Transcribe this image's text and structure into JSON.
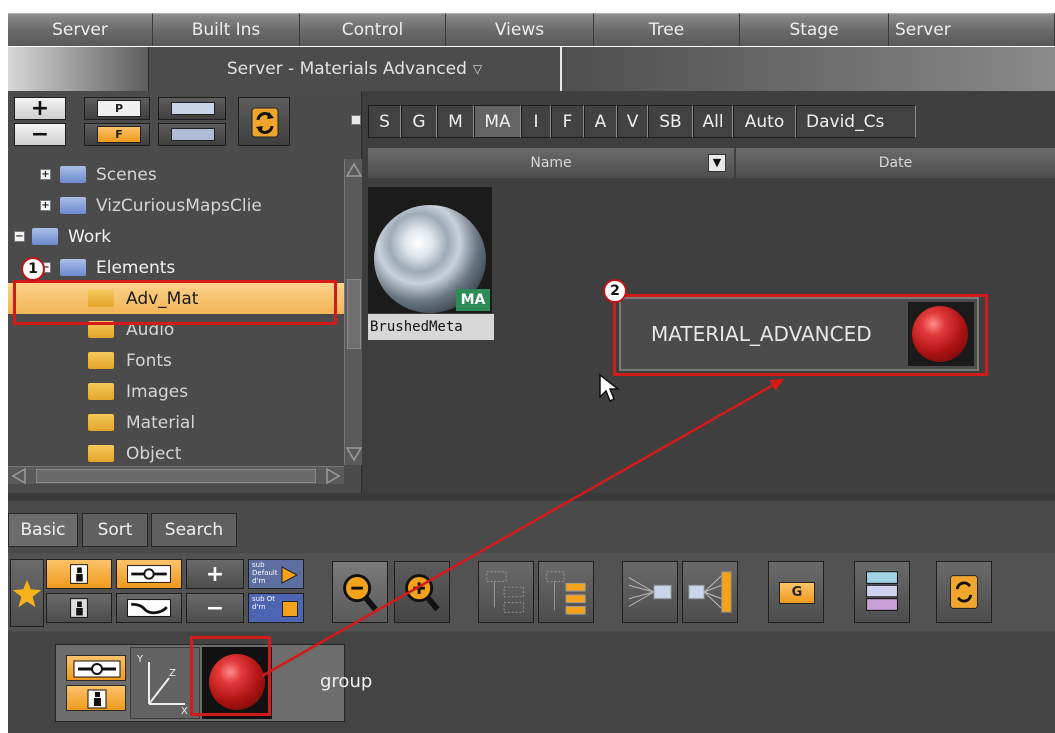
{
  "menu": {
    "items": [
      "Server",
      "Built Ins",
      "Control",
      "Views",
      "Tree",
      "Stage",
      "Server"
    ]
  },
  "title": {
    "combo_label": "Server - Materials Advanced",
    "combo_arrow": "▽"
  },
  "left_toolbar": {
    "add_label": "+",
    "remove_label": "−",
    "project_badge": "P",
    "folder_badge": "F"
  },
  "tree": {
    "rows": [
      {
        "label": "Scenes",
        "expander": "+",
        "icon": "blue-folder"
      },
      {
        "label": "VizCuriousMapsClie",
        "expander": "+",
        "icon": "blue-folder"
      },
      {
        "label": "Work",
        "expander": "−",
        "icon": "blue-folder-open"
      },
      {
        "label": "Elements",
        "expander": "−",
        "icon": "blue-folder-open"
      },
      {
        "label": "Adv_Mat",
        "icon": "yellow-folder",
        "selected": true
      },
      {
        "label": "Audio",
        "icon": "yellow-folder"
      },
      {
        "label": "Fonts",
        "icon": "yellow-folder"
      },
      {
        "label": "Images",
        "icon": "yellow-folder"
      },
      {
        "label": "Material",
        "icon": "yellow-folder"
      },
      {
        "label": "Object",
        "icon": "yellow-folder"
      }
    ]
  },
  "filter_tabs": [
    {
      "label": "S"
    },
    {
      "label": "G"
    },
    {
      "label": "M"
    },
    {
      "label": "MA",
      "active": true
    },
    {
      "label": "I"
    },
    {
      "label": "F"
    },
    {
      "label": "A"
    },
    {
      "label": "V"
    },
    {
      "label": "SB"
    },
    {
      "label": "All"
    },
    {
      "label": "Auto"
    },
    {
      "label": "David_Cs"
    }
  ],
  "columns": {
    "name": "Name",
    "date": "Date",
    "dropdown_glyph": "▼"
  },
  "asset": {
    "name": "BrushedMeta",
    "badge": "MA"
  },
  "drop_target": {
    "label": "MATERIAL_ADVANCED"
  },
  "callouts": [
    "1",
    "2"
  ],
  "bottom_tabs": [
    {
      "label": "Basic",
      "active": true
    },
    {
      "label": "Sort"
    },
    {
      "label": "Search"
    }
  ],
  "bottom_toolbar": {
    "plus": "+",
    "minus": "−",
    "sub_default": "sub Default",
    "sub_default_small": "d'rn",
    "sub_other": "sub Ot",
    "sub_other_small": "d'rn",
    "group_badge": "G"
  },
  "node": {
    "label": "group",
    "axis_y": "Y",
    "axis_z": "Z",
    "axis_x": "X"
  },
  "colors": {
    "callout_red": "#d51a1a",
    "accent_orange": "#f3b555",
    "ma_badge_green": "#2e8b55"
  }
}
